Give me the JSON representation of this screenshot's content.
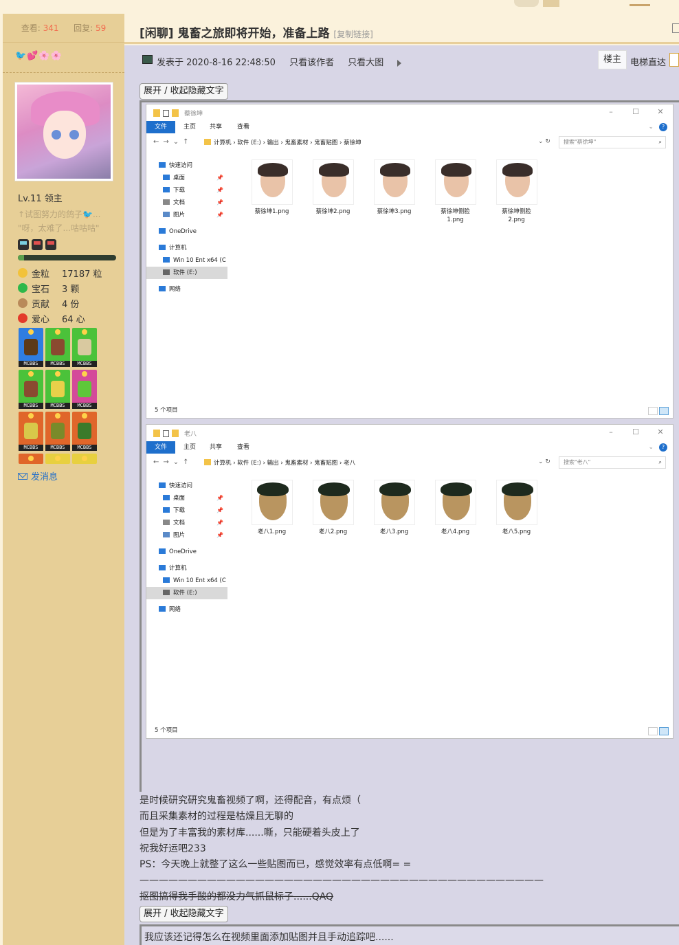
{
  "thread": {
    "views_label": "查看:",
    "views": "341",
    "replies_label": "回复:",
    "replies": "59",
    "title": "[闲聊] 鬼畜之旅即将开始，准备上路",
    "copy_link": "[复制链接]"
  },
  "user": {
    "emoji_bar": [
      "🐦",
      "💕",
      "🌸",
      "🌸"
    ],
    "level": "Lv.11 领主",
    "signature_line1": "↑试图努力的鸽子🐦...",
    "signature_line2": "\"呀，太难了...咕咕咕\"",
    "exp_progress": 0.06,
    "credits": [
      {
        "icon": "gold-nugget-icon",
        "label": "金粒",
        "value": "17187 粒",
        "color": "#f2c23a"
      },
      {
        "icon": "emerald-icon",
        "label": "宝石",
        "value": "3 颗",
        "color": "#2fb84a"
      },
      {
        "icon": "cookie-icon",
        "label": "贡献",
        "value": "4 份",
        "color": "#b98a5a"
      },
      {
        "icon": "apple-icon",
        "label": "爱心",
        "value": "64 心",
        "color": "#e33a2a"
      }
    ],
    "badge_tag": "MCBBS",
    "send_message": "发消息"
  },
  "post": {
    "posted_at": "发表于 2020-8-16 22:48:50",
    "only_author": "只看该作者",
    "big_image": "只看大图",
    "floor": "楼主",
    "jump": "电梯直达",
    "toggle_hidden": "展开 / 收起隐藏文字",
    "lines": [
      "是时候研究研究鬼畜视频了啊，还得配音，有点烦（",
      "而且采集素材的过程是枯燥且无聊的",
      "但是为了丰富我的素材库......嘶，只能硬着头皮上了",
      "祝我好运吧233",
      "PS：今天晚上就整了这么一些贴图而已，感觉效率有点低啊= =",
      "——————————————————————————————————————————"
    ],
    "strike_line": "抠图搞得我手酸的都没力气抓鼠标子......QAQ",
    "hidden_text": "我应该还记得怎么在视频里面添加贴图并且手动追踪吧......"
  },
  "explorer_common": {
    "file_tab": "文件",
    "home_tab": "主页",
    "share_tab": "共享",
    "view_tab": "查看",
    "nav": [
      "快速访问",
      "桌面",
      "下载",
      "文档",
      "图片",
      "OneDrive",
      "计算机",
      "Win 10 Ent x64 (C",
      "软件 (E:)",
      "网络"
    ],
    "status": "5 个项目"
  },
  "explorer1": {
    "window_title": "蔡徐坤",
    "path": "计算机 › 软件 (E:) › 输出 › 鬼畜素材 › 鬼畜贴图 › 蔡徐坤",
    "search_placeholder": "搜索\"蔡徐坤\"",
    "files": [
      "蔡徐坤1.png",
      "蔡徐坤2.png",
      "蔡徐坤3.png",
      "蔡徐坤侧脸\n1.png",
      "蔡徐坤侧脸\n2.png"
    ]
  },
  "explorer2": {
    "window_title": "老八",
    "path": "计算机 › 软件 (E:) › 输出 › 鬼畜素材 › 鬼畜贴图 › 老八",
    "search_placeholder": "搜索\"老八\"",
    "files": [
      "老八1.png",
      "老八2.png",
      "老八3.png",
      "老八4.png",
      "老八5.png"
    ]
  }
}
